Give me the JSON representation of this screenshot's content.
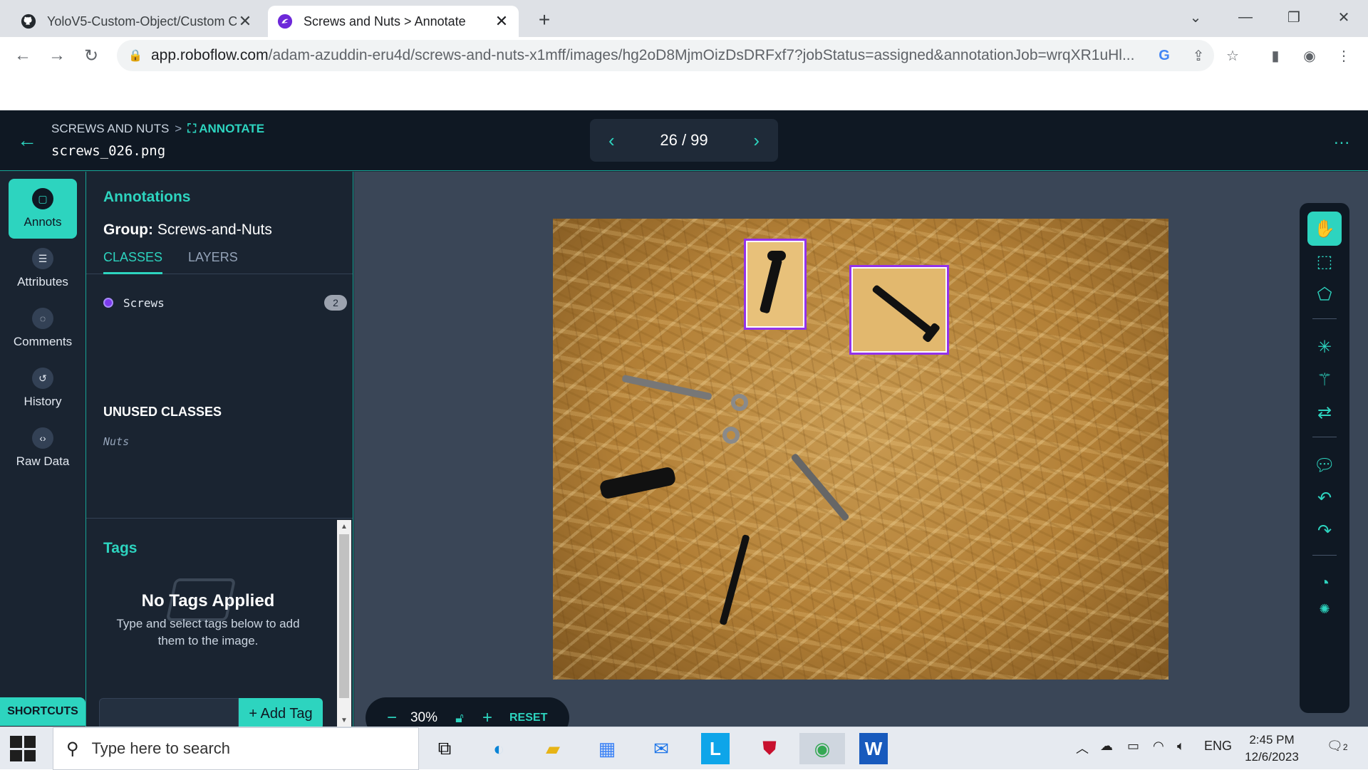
{
  "browser": {
    "tabs": [
      {
        "title": "YoloV5-Custom-Object/Custom C",
        "icon": "github-icon",
        "active": false
      },
      {
        "title": "Screws and Nuts > Annotate",
        "icon": "roboflow-icon",
        "active": true
      }
    ],
    "url_host": "app.roboflow.com",
    "url_path": "/adam-azuddin-eru4d/screws-and-nuts-x1mff/images/hg2oD8MjmOizDsDRFxf7?jobStatus=assigned&annotationJob=wrqXR1uHl..."
  },
  "app": {
    "breadcrumb_project": "SCREWS AND NUTS",
    "breadcrumb_sep": ">",
    "breadcrumb_current": "ANNOTATE",
    "filename": "screws_026.png",
    "pager": {
      "current": "26 / 99"
    },
    "more": "...",
    "rail": [
      {
        "label": "Annots",
        "icon": "annotation-icon",
        "active": true
      },
      {
        "label": "Attributes",
        "icon": "list-icon",
        "active": false
      },
      {
        "label": "Comments",
        "icon": "comment-icon",
        "active": false
      },
      {
        "label": "History",
        "icon": "history-icon",
        "active": false
      },
      {
        "label": "Raw Data",
        "icon": "code-icon",
        "active": false
      }
    ],
    "shortcuts": "SHORTCUTS",
    "panel": {
      "heading": "Annotations",
      "group_label": "Group:",
      "group_value": "Screws-and-Nuts",
      "tab_classes": "CLASSES",
      "tab_layers": "LAYERS",
      "classes": [
        {
          "name": "Screws",
          "count": "2",
          "color": "#7c3aed"
        }
      ],
      "unused_heading": "UNUSED CLASSES",
      "unused": [
        "Nuts"
      ],
      "tags_heading": "Tags",
      "no_tags_title": "No Tags Applied",
      "no_tags_sub": "Type and select tags below to add them to the image.",
      "add_tag": "+ Add Tag"
    },
    "zoom": {
      "minus": "−",
      "value": "30%",
      "plus": "+",
      "reset": "RESET"
    },
    "tools": [
      "hand-icon",
      "bounding-box-icon",
      "polygon-icon",
      "smart-select-icon",
      "magic-wand-icon",
      "repeat-icon",
      "comment-icon",
      "undo-icon",
      "redo-icon",
      "speed-icon",
      "settings-icon"
    ],
    "accent": "#2dd4bf",
    "box_color": "#9333ea"
  },
  "taskbar": {
    "search_placeholder": "Type here to search",
    "lang": "ENG",
    "time": "2:45 PM",
    "date": "12/6/2023",
    "notifications": "2"
  }
}
